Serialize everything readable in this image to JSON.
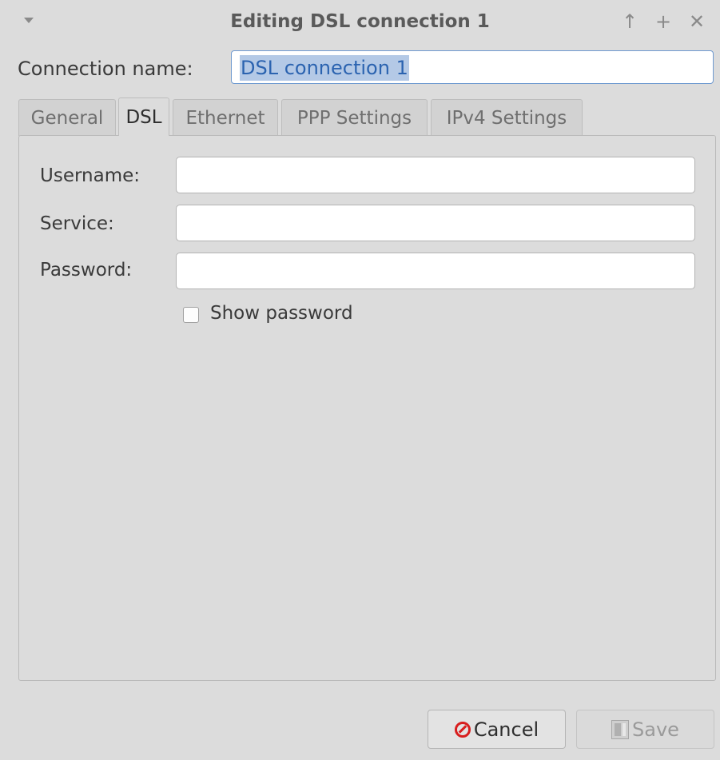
{
  "window": {
    "title": "Editing DSL connection 1",
    "controls": {
      "menu_icon": "chevron-down-icon",
      "up_icon": "arrow-up-icon",
      "maximize_icon": "plus-icon",
      "close_icon": "close-icon",
      "up_glyph": "↑",
      "maximize_glyph": "+",
      "close_glyph": "✕"
    }
  },
  "connection": {
    "label": "Connection name:",
    "value": "DSL connection 1"
  },
  "tabs": [
    {
      "label": "General",
      "active": false
    },
    {
      "label": "DSL",
      "active": true
    },
    {
      "label": "Ethernet",
      "active": false
    },
    {
      "label": "PPP Settings",
      "active": false
    },
    {
      "label": "IPv4 Settings",
      "active": false
    }
  ],
  "dsl": {
    "username": {
      "label": "Username:",
      "value": ""
    },
    "service": {
      "label": "Service:",
      "value": ""
    },
    "password": {
      "label": "Password:",
      "value": ""
    },
    "show_password": {
      "label": "Show password",
      "checked": false
    }
  },
  "buttons": {
    "cancel": {
      "label": "Cancel",
      "icon": "cancel-icon"
    },
    "save": {
      "label": "Save",
      "icon": "save-icon",
      "enabled": false
    }
  },
  "colors": {
    "selection_bg": "#b4c9e6",
    "selection_text": "#2b63b0",
    "cancel_icon": "#d81e1e"
  }
}
